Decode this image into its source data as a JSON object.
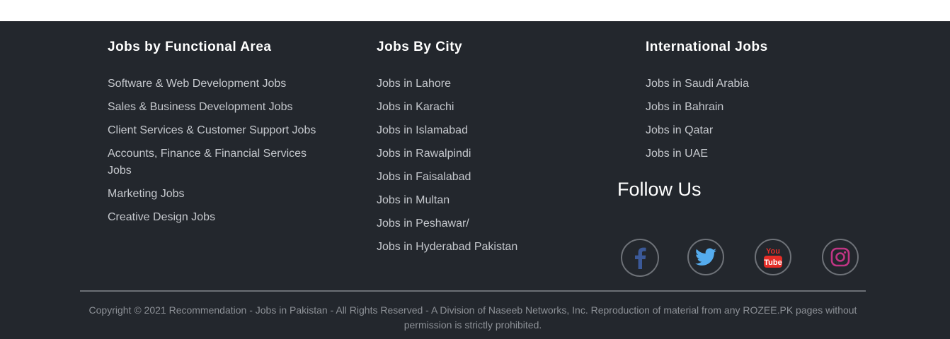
{
  "functional": {
    "title": "Jobs by Functional Area",
    "links": [
      "Software & Web Development Jobs",
      "Sales & Business Development Jobs",
      "Client Services & Customer Support Jobs",
      "Accounts, Finance & Financial Services Jobs",
      "Marketing Jobs",
      "Creative Design Jobs"
    ]
  },
  "city": {
    "title": "Jobs By City",
    "links": [
      "Jobs in Lahore",
      "Jobs in Karachi",
      "Jobs in Islamabad",
      "Jobs in Rawalpindi",
      "Jobs in Faisalabad",
      "Jobs in Multan",
      "Jobs in Peshawar/",
      "Jobs in Hyderabad Pakistan"
    ]
  },
  "international": {
    "title": "International Jobs",
    "links": [
      "Jobs in Saudi Arabia",
      "Jobs in Bahrain",
      "Jobs in Qatar",
      "Jobs in UAE"
    ]
  },
  "follow": {
    "title": "Follow Us",
    "icons": [
      "facebook-icon",
      "twitter-icon",
      "youtube-icon",
      "instagram-icon"
    ],
    "youtube_logo_text": [
      "You",
      "Tube"
    ]
  },
  "colors": {
    "background": "#23272d",
    "facebook": "#3b5998",
    "twitter": "#55acee",
    "youtube": "#e52d27",
    "instagram": "#c13584"
  },
  "copyright": "Copyright © 2021 Recommendation - Jobs in Pakistan - All Rights Reserved - A Division of Naseeb Networks, Inc. Reproduction of material from any ROZEE.PK pages without permission is strictly prohibited."
}
